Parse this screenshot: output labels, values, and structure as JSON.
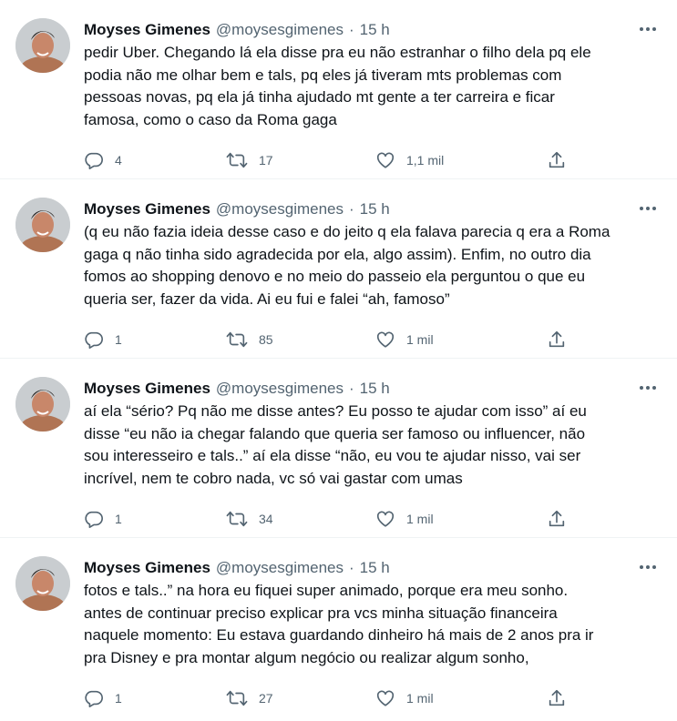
{
  "tweets": [
    {
      "author_name": "Moyses Gimenes",
      "handle": "@moysesgimenes",
      "separator": "·",
      "time": "15 h",
      "text": "pedir Uber. Chegando lá ela disse pra eu não estranhar o filho dela pq ele\npodia não me olhar bem e tals, pq eles já tiveram mts problemas com\npessoas novas, pq ela já tinha ajudado mt gente a ter carreira e ficar\nfamosa, como o caso da Roma gaga",
      "replies": "4",
      "retweets": "17",
      "likes": "1,1 mil"
    },
    {
      "author_name": "Moyses Gimenes",
      "handle": "@moysesgimenes",
      "separator": "·",
      "time": "15 h",
      "text": "(q eu não fazia ideia desse caso e do jeito q ela falava parecia q era a Roma\ngaga q não tinha sido agradecida por ela, algo assim). Enfim, no outro dia\nfomos ao shopping denovo e no meio do passeio ela perguntou o que eu\nqueria ser, fazer da vida. Ai eu fui e falei “ah, famoso”",
      "replies": "1",
      "retweets": "85",
      "likes": "1 mil"
    },
    {
      "author_name": "Moyses Gimenes",
      "handle": "@moysesgimenes",
      "separator": "·",
      "time": "15 h",
      "text": "aí ela “sério? Pq não me disse antes? Eu posso te ajudar com isso” aí eu\ndisse “eu não ia chegar falando que queria ser famoso ou influencer, não\nsou interesseiro e tals..” aí ela disse “não, eu vou te ajudar nisso, vai ser\nincrível, nem te cobro nada, vc só vai gastar com umas",
      "replies": "1",
      "retweets": "34",
      "likes": "1 mil"
    },
    {
      "author_name": "Moyses Gimenes",
      "handle": "@moysesgimenes",
      "separator": "·",
      "time": "15 h",
      "text": "fotos e tals..” na hora eu fiquei super animado, porque era meu sonho.\nantes de continuar preciso explicar pra vcs minha situação financeira\nnaquele momento: Eu estava guardando dinheiro há mais de 2 anos pra ir\npra Disney e pra montar algum negócio ou realizar algum sonho,",
      "replies": "1",
      "retweets": "27",
      "likes": "1 mil"
    }
  ],
  "icons": {
    "avatar": "profile-photo",
    "more": "more-options-icon",
    "reply": "reply-icon",
    "retweet": "retweet-icon",
    "like": "heart-icon",
    "share": "share-icon"
  },
  "colors": {
    "text": "#0f1419",
    "secondary": "#536471",
    "divider": "#eff3f4",
    "background": "#ffffff"
  }
}
